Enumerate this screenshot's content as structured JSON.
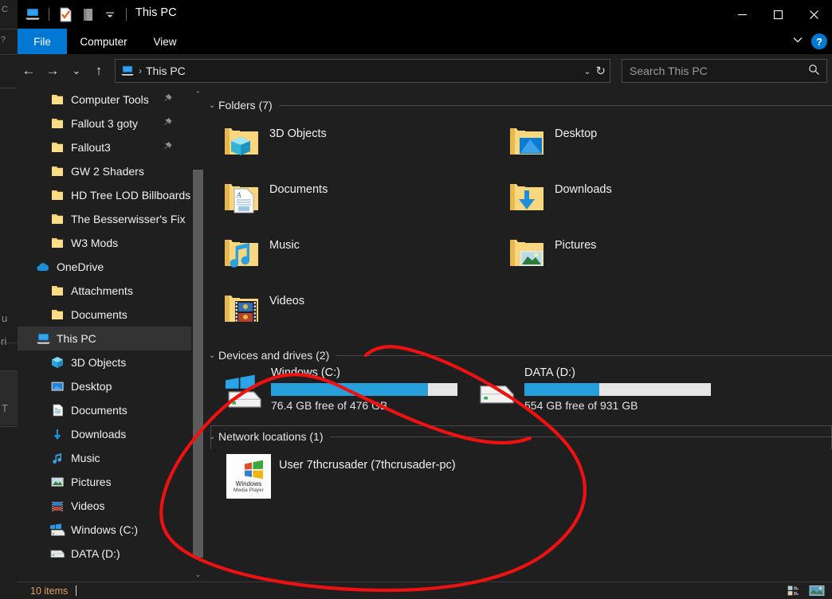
{
  "window": {
    "title": "This PC",
    "quick_access": [
      "this-pc-icon",
      "properties-icon",
      "new-folder-icon",
      "customize-dropdown-icon"
    ],
    "caption": {
      "minimize": "—",
      "maximize": "☐",
      "close": "✕"
    }
  },
  "ribbon": {
    "tabs": [
      {
        "label": "File",
        "active": true
      },
      {
        "label": "Computer",
        "active": false
      },
      {
        "label": "View",
        "active": false
      }
    ],
    "collapse_label": "⌄",
    "help_label": "?"
  },
  "nav": {
    "back": "←",
    "forward": "→",
    "recent": "⌄",
    "up": "↑",
    "address": {
      "icon": "this-pc-icon",
      "separator": "›",
      "text": "This PC",
      "dropdown": "⌄",
      "refresh": "↻"
    },
    "search": {
      "placeholder": "Search This PC",
      "icon": "search-icon"
    }
  },
  "sidebar": {
    "items": [
      {
        "label": "Computer Tools",
        "icon": "folder-icon",
        "indent": 1,
        "pinned": true,
        "selected": false
      },
      {
        "label": "Fallout 3 goty",
        "icon": "folder-icon",
        "indent": 1,
        "pinned": true,
        "selected": false
      },
      {
        "label": "Fallout3",
        "icon": "folder-icon",
        "indent": 1,
        "pinned": true,
        "selected": false
      },
      {
        "label": "GW 2 Shaders",
        "icon": "folder-icon",
        "indent": 1,
        "pinned": false,
        "selected": false
      },
      {
        "label": "HD Tree LOD Billboards",
        "icon": "folder-icon",
        "indent": 1,
        "pinned": false,
        "selected": false
      },
      {
        "label": "The Besserwisser's Fix",
        "icon": "folder-icon",
        "indent": 1,
        "pinned": false,
        "selected": false
      },
      {
        "label": "W3 Mods",
        "icon": "folder-icon",
        "indent": 1,
        "pinned": false,
        "selected": false
      },
      {
        "label": "OneDrive",
        "icon": "onedrive-icon",
        "indent": 0,
        "pinned": false,
        "selected": false
      },
      {
        "label": "Attachments",
        "icon": "folder-icon",
        "indent": 1,
        "pinned": false,
        "selected": false
      },
      {
        "label": "Documents",
        "icon": "folder-icon",
        "indent": 1,
        "pinned": false,
        "selected": false
      },
      {
        "label": "This PC",
        "icon": "this-pc-icon",
        "indent": 0,
        "pinned": false,
        "selected": true
      },
      {
        "label": "3D Objects",
        "icon": "3d-objects-icon",
        "indent": 1,
        "pinned": false,
        "selected": false
      },
      {
        "label": "Desktop",
        "icon": "desktop-icon",
        "indent": 1,
        "pinned": false,
        "selected": false
      },
      {
        "label": "Documents",
        "icon": "documents-icon",
        "indent": 1,
        "pinned": false,
        "selected": false
      },
      {
        "label": "Downloads",
        "icon": "downloads-icon",
        "indent": 1,
        "pinned": false,
        "selected": false
      },
      {
        "label": "Music",
        "icon": "music-icon",
        "indent": 1,
        "pinned": false,
        "selected": false
      },
      {
        "label": "Pictures",
        "icon": "pictures-icon",
        "indent": 1,
        "pinned": false,
        "selected": false
      },
      {
        "label": "Videos",
        "icon": "videos-icon",
        "indent": 1,
        "pinned": false,
        "selected": false
      },
      {
        "label": "Windows (C:)",
        "icon": "windows-drive-icon",
        "indent": 1,
        "pinned": false,
        "selected": false
      },
      {
        "label": "DATA (D:)",
        "icon": "drive-icon",
        "indent": 1,
        "pinned": false,
        "selected": false
      }
    ],
    "scroll_up": "⌃",
    "scroll_down": "⌄"
  },
  "content": {
    "groups": [
      {
        "title": "Folders (7)",
        "chevron": "⌄"
      },
      {
        "title": "Devices and drives (2)",
        "chevron": "⌄"
      },
      {
        "title": "Network locations (1)",
        "chevron": "⌄"
      }
    ],
    "folders": [
      {
        "name": "3D Objects",
        "icon": "folder-3d-objects-icon"
      },
      {
        "name": "Desktop",
        "icon": "folder-desktop-icon"
      },
      {
        "name": "Documents",
        "icon": "folder-documents-icon"
      },
      {
        "name": "Downloads",
        "icon": "folder-downloads-icon"
      },
      {
        "name": "Music",
        "icon": "folder-music-icon"
      },
      {
        "name": "Pictures",
        "icon": "folder-pictures-icon"
      },
      {
        "name": "Videos",
        "icon": "folder-videos-icon"
      }
    ],
    "drives": [
      {
        "name": "Windows (C:)",
        "free_text": "76.4 GB free of 476 GB",
        "used_percent": 84,
        "icon": "windows-drive-icon",
        "bar_color": "#26a0da",
        "track_color": "#e6e6e6"
      },
      {
        "name": "DATA (D:)",
        "free_text": "554 GB free of 931 GB",
        "used_percent": 40,
        "icon": "hard-drive-icon",
        "bar_color": "#26a0da",
        "track_color": "#e6e6e6"
      }
    ],
    "network": [
      {
        "name": "User 7thcrusader (7thcrusader-pc)",
        "icon": "windows-media-player-icon",
        "icon_line1": "Windows",
        "icon_line2": "Media Player"
      }
    ]
  },
  "statusbar": {
    "item_count": "10 items",
    "view_buttons": [
      "details-view-icon",
      "large-icons-view-icon"
    ]
  },
  "annotation": {
    "type": "freehand-oval",
    "color": "#ee1111",
    "stroke_width": 4
  },
  "background_window": {
    "fragments": [
      "C",
      "?",
      "u",
      "ri",
      "T"
    ]
  }
}
